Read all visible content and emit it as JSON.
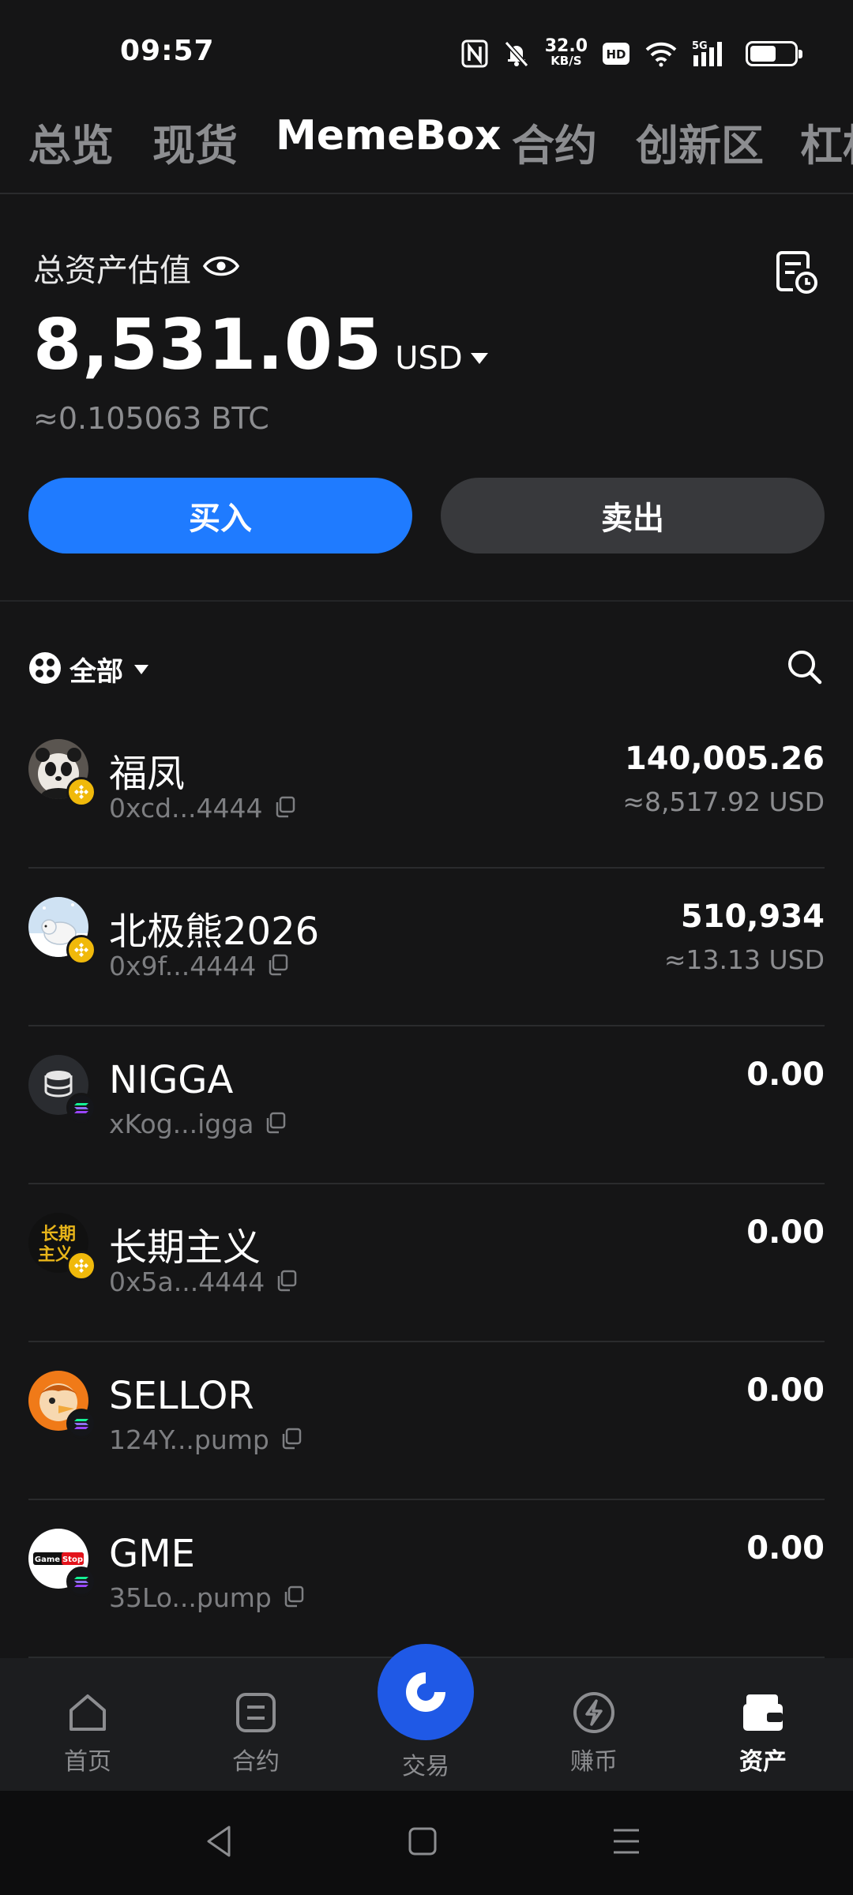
{
  "status_bar": {
    "time": "09:57",
    "net_speed_value": "32.0",
    "net_speed_unit": "KB/S",
    "hd_label": "HD",
    "network": "5G",
    "icons": [
      "nfc-icon",
      "mute-bell-icon",
      "hd-icon",
      "wifi-icon",
      "signal-icon",
      "battery-icon"
    ]
  },
  "top_tabs": [
    {
      "label": "总览",
      "active": false
    },
    {
      "label": "现货",
      "active": false
    },
    {
      "label": "MemeBox",
      "active": true
    },
    {
      "label": "合约",
      "active": false
    },
    {
      "label": "创新区",
      "active": false
    },
    {
      "label": "杠杆",
      "active": false
    }
  ],
  "summary": {
    "title": "总资产估值",
    "total_value": "8,531.05",
    "currency": "USD",
    "btc_value": "≈0.105063  BTC",
    "buy_label": "买入",
    "sell_label": "卖出"
  },
  "filter": {
    "label": "全部"
  },
  "tokens": [
    {
      "name": "福凤",
      "address": "0xcd...4444",
      "amount": "140,005.26",
      "usd": "≈8,517.92 USD",
      "chain": "bnb",
      "avatar": "panda"
    },
    {
      "name": "北极熊2026",
      "address": "0x9f...4444",
      "amount": "510,934",
      "usd": "≈13.13 USD",
      "chain": "bnb",
      "avatar": "polar-bear"
    },
    {
      "name": "NIGGA",
      "address": "xKog...igga",
      "amount": "0.00",
      "usd": "",
      "chain": "sol",
      "avatar": "coins"
    },
    {
      "name": "长期主义",
      "address": "0x5a...4444",
      "amount": "0.00",
      "usd": "",
      "chain": "bnb",
      "avatar": "calligraphy",
      "avatar_text": "长期主义"
    },
    {
      "name": "SELLOR",
      "address": "124Y...pump",
      "amount": "0.00",
      "usd": "",
      "chain": "sol",
      "avatar": "bird"
    },
    {
      "name": "GME",
      "address": "35Lo...pump",
      "amount": "0.00",
      "usd": "",
      "chain": "sol",
      "avatar": "gamestop",
      "avatar_text": "GameStop"
    }
  ],
  "bottom_nav": {
    "home": "首页",
    "futures": "合约",
    "trade": "交易",
    "earn": "赚币",
    "assets": "资产",
    "active": "assets"
  },
  "colors": {
    "background": "#151516",
    "primary_blue": "#1f7bff",
    "bnb_yellow": "#f0b90b",
    "muted_text": "#8c8d90"
  }
}
